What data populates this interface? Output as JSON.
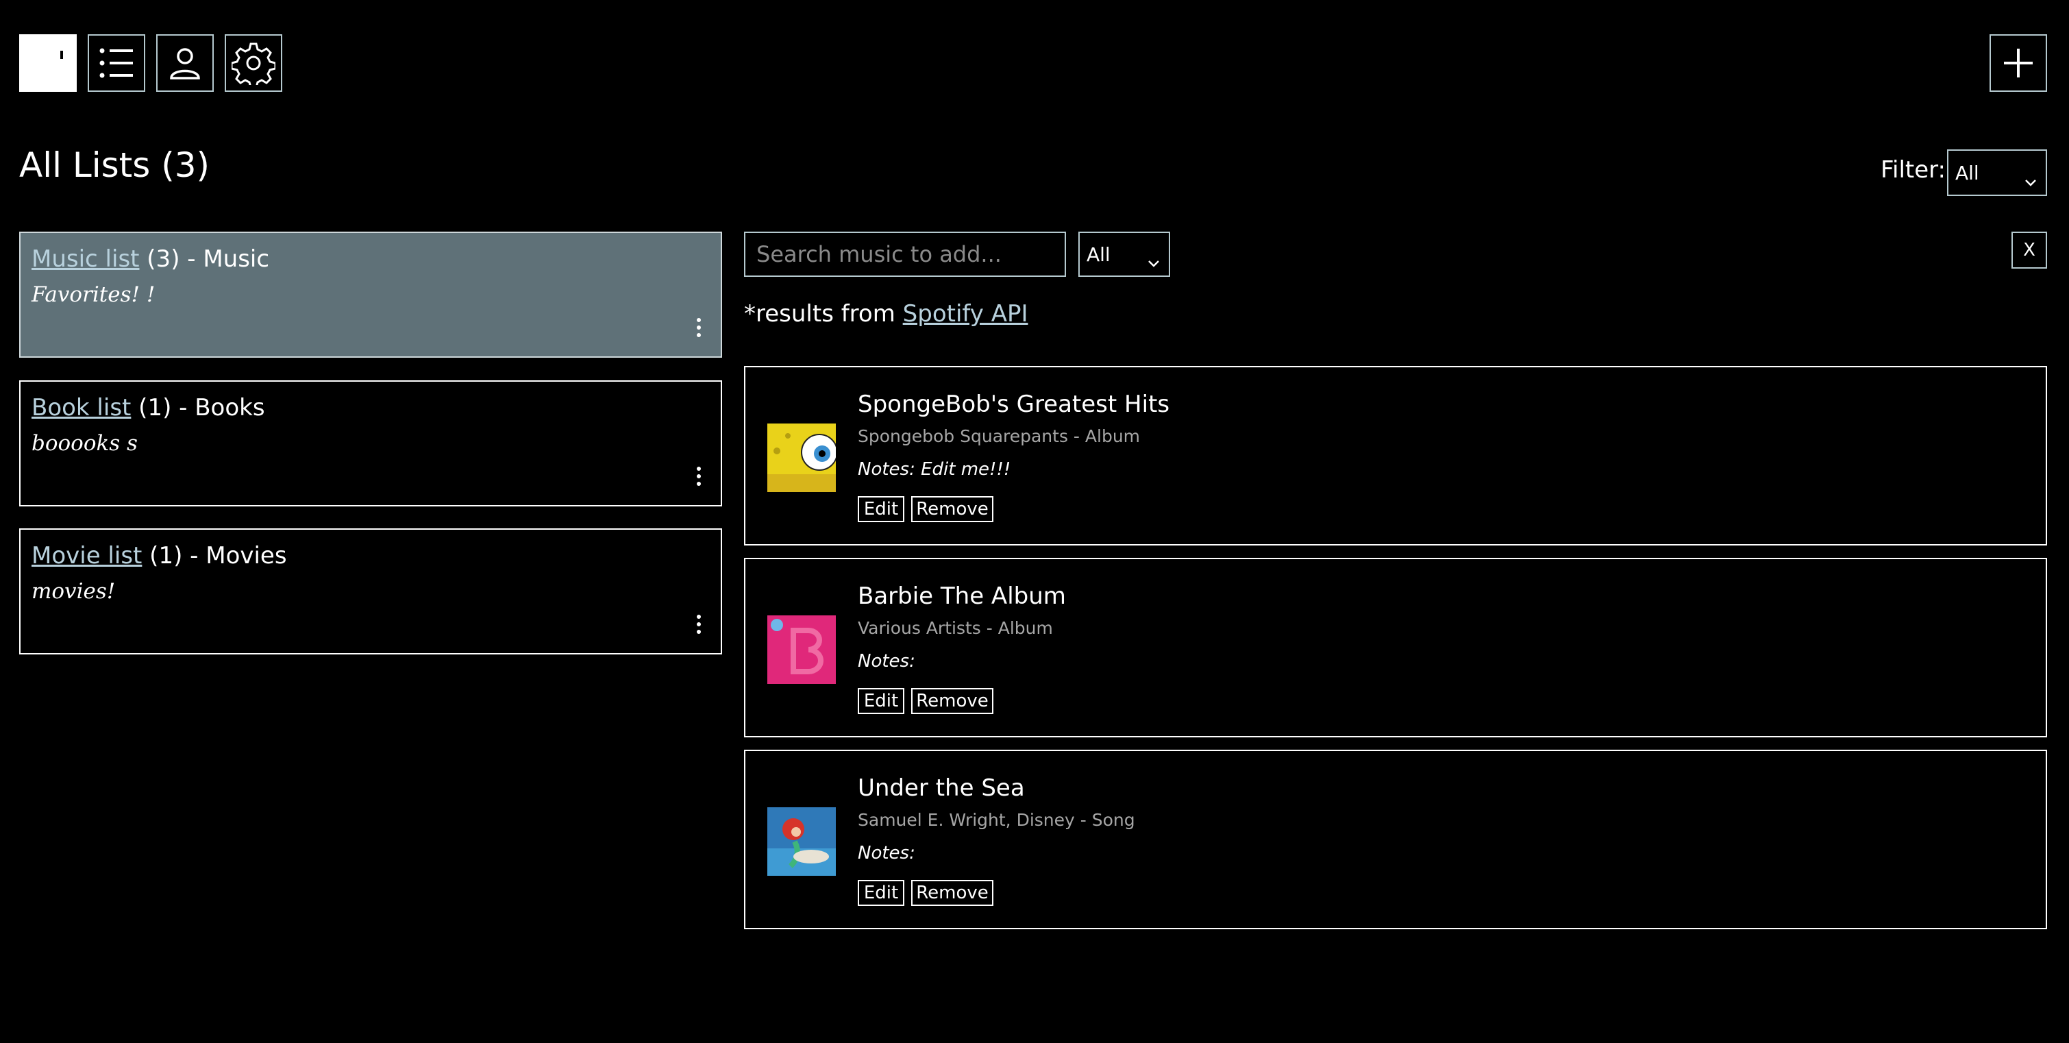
{
  "toolbar": {
    "items": [
      {
        "name": "home-logo-button",
        "icon": "app-logo-icon"
      },
      {
        "name": "lists-button",
        "icon": "list-icon"
      },
      {
        "name": "profile-button",
        "icon": "user-icon"
      },
      {
        "name": "settings-button",
        "icon": "gear-icon"
      }
    ],
    "add_button_icon": "plus-icon"
  },
  "heading": {
    "title": "All Lists (3)",
    "filter_label": "Filter:",
    "filter_value": "All"
  },
  "lists": [
    {
      "link": "Music list",
      "meta": " (3) - Music",
      "description": "Favorites! !",
      "active": true
    },
    {
      "link": "Book list",
      "meta": " (1) - Books",
      "description": "booooks s",
      "active": false
    },
    {
      "link": "Movie list",
      "meta": " (1) - Movies",
      "description": "movies!",
      "active": false
    }
  ],
  "search": {
    "placeholder": "Search music to add...",
    "type_value": "All",
    "close_label": "X",
    "results_prefix": "*results from ",
    "results_link": "Spotify API"
  },
  "items": [
    {
      "title": "SpongeBob's Greatest Hits",
      "subtitle": "Spongebob Squarepants - Album",
      "notes": "Notes: Edit me!!!",
      "edit_label": "Edit",
      "remove_label": "Remove",
      "thumb_color": "#e9d21a"
    },
    {
      "title": "Barbie The Album",
      "subtitle": "Various Artists - Album",
      "notes": "Notes:",
      "edit_label": "Edit",
      "remove_label": "Remove",
      "thumb_color": "#e0287a"
    },
    {
      "title": "Under the Sea",
      "subtitle": "Samuel E. Wright, Disney - Song",
      "notes": "Notes:",
      "edit_label": "Edit",
      "remove_label": "Remove",
      "thumb_color": "#2f79b8"
    }
  ],
  "colors": {
    "background": "#000000",
    "active_card": "#5f7178",
    "link": "#b8d1dd",
    "border_accent": "#b5c9cf"
  }
}
